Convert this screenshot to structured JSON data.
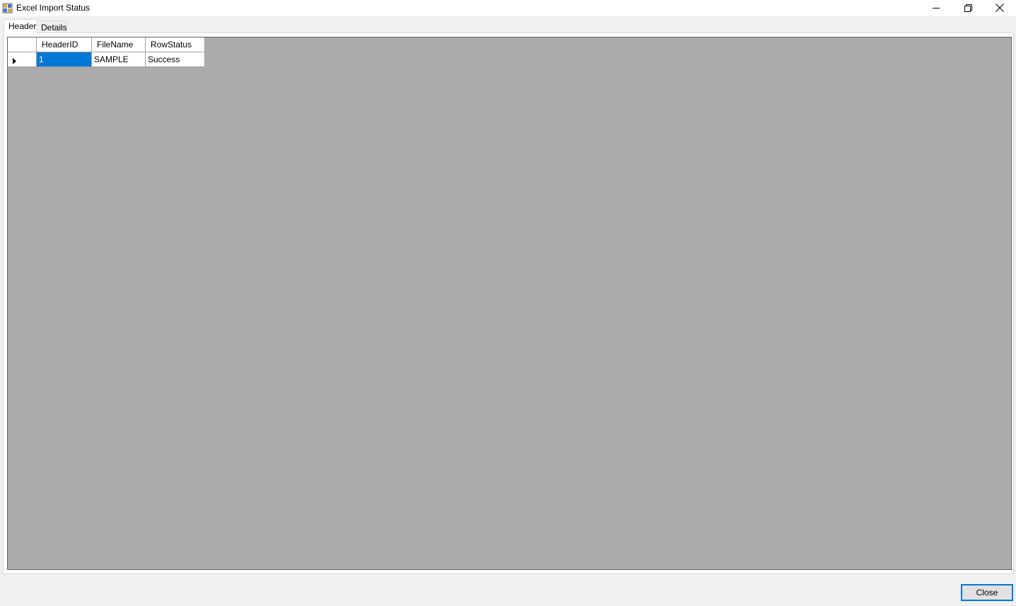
{
  "window": {
    "title": "Excel Import Status",
    "icon": "app-form-icon",
    "controls": [
      "minimize-icon",
      "restore-icon",
      "close-icon"
    ]
  },
  "tabs": [
    {
      "label": "Header",
      "selected": true
    },
    {
      "label": "Details",
      "selected": false
    }
  ],
  "grid": {
    "columns": [
      "HeaderID",
      "FileName",
      "RowStatus"
    ],
    "rows": [
      {
        "HeaderID": "1",
        "FileName": "SAMPLE",
        "RowStatus": "Success",
        "current": true
      }
    ],
    "row_indicator_icon": "current-row-triangle-icon"
  },
  "footer": {
    "close_label": "Close"
  },
  "colors": {
    "selection": "#0078d7",
    "grid_background": "#ababab",
    "button_focus_border": "#0078d7"
  }
}
